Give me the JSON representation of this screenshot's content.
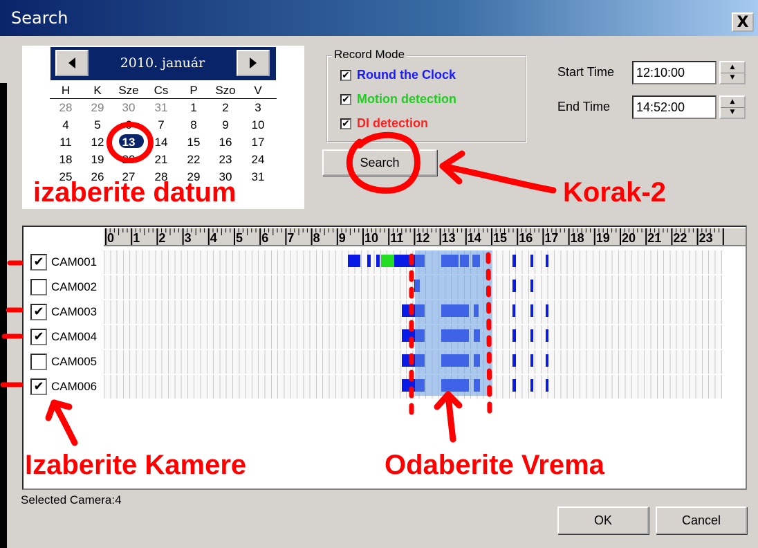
{
  "window": {
    "title": "Search",
    "close_label": "X"
  },
  "calendar": {
    "month_label": "2010. január",
    "prev_icon": "triangle-left-icon",
    "next_icon": "triangle-right-icon",
    "weekdays": [
      "H",
      "K",
      "Sze",
      "Cs",
      "P",
      "Szo",
      "V"
    ],
    "weeks": [
      [
        "28",
        "29",
        "30",
        "31",
        "1",
        "2",
        "3"
      ],
      [
        "4",
        "5",
        "6",
        "7",
        "8",
        "9",
        "10"
      ],
      [
        "11",
        "12",
        "13",
        "14",
        "15",
        "16",
        "17"
      ],
      [
        "18",
        "19",
        "20",
        "21",
        "22",
        "23",
        "24"
      ],
      [
        "25",
        "26",
        "27",
        "28",
        "29",
        "30",
        "31"
      ]
    ],
    "selected_day": "13"
  },
  "record_mode": {
    "legend": "Record Mode",
    "options": [
      {
        "label": "Round the Clock",
        "checked": true,
        "color": "#1a1aff"
      },
      {
        "label": "Motion detection",
        "checked": true,
        "color": "#22cc22"
      },
      {
        "label": "DI detection",
        "checked": true,
        "color": "#ff2020"
      }
    ]
  },
  "time": {
    "start_label": "Start Time",
    "start_value": "12:10:00",
    "end_label": "End Time",
    "end_value": "14:52:00"
  },
  "search_button": "Search",
  "timeline": {
    "hours": [
      "0",
      "1",
      "2",
      "3",
      "4",
      "5",
      "6",
      "7",
      "8",
      "9",
      "10",
      "11",
      "12",
      "13",
      "14",
      "15",
      "16",
      "17",
      "18",
      "19",
      "20",
      "21",
      "22",
      "23"
    ],
    "cameras": [
      {
        "name": "CAM001",
        "checked": true
      },
      {
        "name": "CAM002",
        "checked": false
      },
      {
        "name": "CAM003",
        "checked": true
      },
      {
        "name": "CAM004",
        "checked": true
      },
      {
        "name": "CAM005",
        "checked": false
      },
      {
        "name": "CAM006",
        "checked": true
      }
    ],
    "selection": {
      "start": "12:10:00",
      "end": "14:52:00"
    }
  },
  "status": {
    "selected_camera": "Selected Camera:4"
  },
  "buttons": {
    "ok": "OK",
    "cancel": "Cancel"
  },
  "annotations": {
    "date": "izaberite datum",
    "step2": "Korak-2",
    "cameras": "Izaberite Kamere",
    "time": "Odaberite Vrema"
  },
  "colors": {
    "round_the_clock": "#1a1aff",
    "motion": "#22dd22",
    "di": "#ff2020",
    "marker": "#ff0000",
    "selection": "#69a0e6"
  }
}
